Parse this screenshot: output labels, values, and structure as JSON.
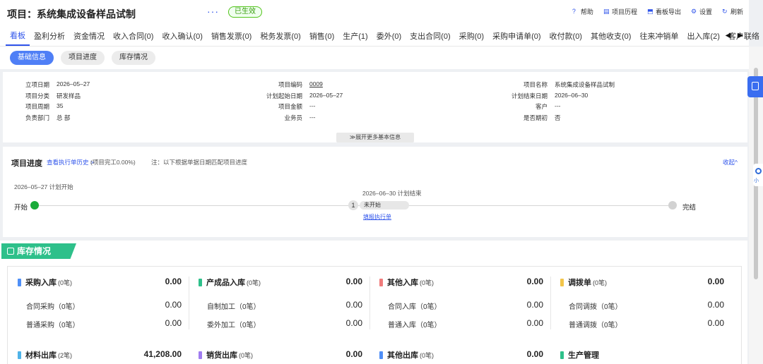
{
  "header": {
    "title": "项目：系统集成设备样品试制",
    "status": "已生效",
    "actions": [
      {
        "icon": "help-icon",
        "glyph": "?",
        "label": "帮助"
      },
      {
        "icon": "history-icon",
        "glyph": "▤",
        "label": "项目历程"
      },
      {
        "icon": "export-icon",
        "glyph": "⬒",
        "label": "看板导出"
      },
      {
        "icon": "gear-icon",
        "glyph": "⚙",
        "label": "设置"
      },
      {
        "icon": "refresh-icon",
        "glyph": "↻",
        "label": "刷新"
      }
    ]
  },
  "tabs": [
    "看板",
    "盈利分析",
    "资金情况",
    "收入合同(0)",
    "收入确认(0)",
    "销售发票(0)",
    "税务发票(0)",
    "销售(0)",
    "生产(1)",
    "委外(0)",
    "支出合同(0)",
    "采购(0)",
    "采购申请单(0)",
    "收付款(0)",
    "其他收支(0)",
    "往来冲销单",
    "出入库(2)",
    "客户联络"
  ],
  "active_tab": "看板",
  "subtabs": [
    "基础信息",
    "项目进度",
    "库存情况"
  ],
  "active_subtab": "基础信息",
  "basic_info": {
    "col1": [
      {
        "label": "立项日期",
        "value": "2026–05–27"
      },
      {
        "label": "项目分类",
        "value": "研发样品"
      },
      {
        "label": "项目周期",
        "value": "35"
      },
      {
        "label": "负责部门",
        "value": "总 部"
      }
    ],
    "col2": [
      {
        "label": "项目编码",
        "value": "0009"
      },
      {
        "label": "计划起始日期",
        "value": "2026–05–27"
      },
      {
        "label": "项目金额",
        "value": "---"
      },
      {
        "label": "业务员",
        "value": "---"
      }
    ],
    "col3": [
      {
        "label": "项目名称",
        "value": "系统集成设备样品试制"
      },
      {
        "label": "计划结束日期",
        "value": "2026–06–30"
      },
      {
        "label": "客户",
        "value": "---"
      },
      {
        "label": "是否期初",
        "value": "否"
      }
    ],
    "expand_label": "≫展开更多基本信息"
  },
  "progress": {
    "title": "项目进度",
    "history_link": "查看执行单历史 >",
    "percent_text": "(项目完工0.00%)",
    "note": "注：以下根据单据日期匹配项目进度",
    "collapse": "收起^",
    "plan_start": "2026–05–27 计划开始",
    "plan_end": "2026–06–30 计划结束",
    "start_label": "开始",
    "step_number": "1",
    "step_status": "未开始",
    "fill_link": "填报执行单",
    "end_label": "完结"
  },
  "stock": {
    "title": "库存情况",
    "sections_top": [
      {
        "name": "采购入库",
        "count": "(0笔)",
        "total": "0.00",
        "color": "#4f8ff7",
        "items": [
          {
            "label": "合同采购（0笔）",
            "value": "0.00"
          },
          {
            "label": "普通采购（0笔）",
            "value": "0.00"
          }
        ]
      },
      {
        "name": "产成品入库",
        "count": "(0笔)",
        "total": "0.00",
        "color": "#2ec08a",
        "items": [
          {
            "label": "自制加工（0笔）",
            "value": "0.00"
          },
          {
            "label": "委外加工（0笔）",
            "value": "0.00"
          }
        ]
      },
      {
        "name": "其他入库",
        "count": "(0笔)",
        "total": "0.00",
        "color": "#f07c7c",
        "items": [
          {
            "label": "合同入库（0笔）",
            "value": "0.00"
          },
          {
            "label": "普通入库（0笔）",
            "value": "0.00"
          }
        ]
      },
      {
        "name": "调拨单",
        "count": "(0笔)",
        "total": "0.00",
        "color": "#f2c54a",
        "items": [
          {
            "label": "合同调拨（0笔）",
            "value": "0.00"
          },
          {
            "label": "普通调拨（0笔）",
            "value": "0.00"
          }
        ]
      }
    ],
    "sections_bottom": [
      {
        "name": "材料出库",
        "count": "(2笔)",
        "total": "41,208.00",
        "color": "#4fb3e8"
      },
      {
        "name": "销货出库",
        "count": "(0笔)",
        "total": "0.00",
        "color": "#a07cf0"
      },
      {
        "name": "其他出库",
        "count": "(0笔)",
        "total": "0.00",
        "color": "#4f8ff7"
      },
      {
        "name": "生产管理",
        "count": "",
        "total": "",
        "color": "#2ec08a"
      }
    ]
  },
  "side": {
    "mini_label": "小"
  }
}
